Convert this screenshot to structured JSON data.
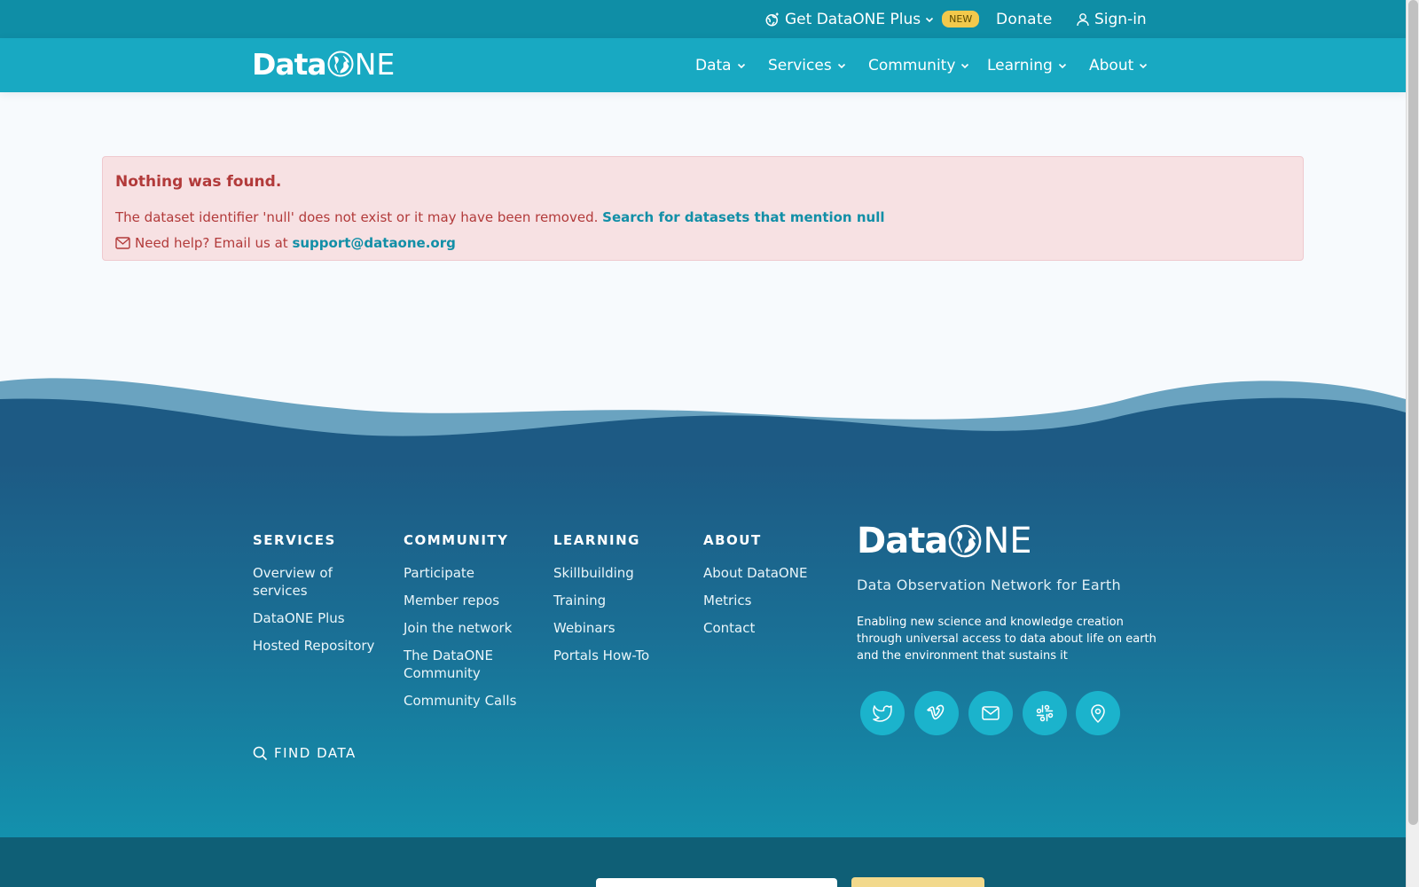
{
  "topbar": {
    "get_plus_label": "Get DataONE Plus",
    "new_badge": "NEW",
    "donate_label": "Donate",
    "signin_label": "Sign-in"
  },
  "brand": {
    "data": "Data",
    "one_o": "O",
    "one_rest": "NE"
  },
  "nav": [
    {
      "label": "Data"
    },
    {
      "label": "Services"
    },
    {
      "label": "Community"
    },
    {
      "label": "Learning"
    },
    {
      "label": "About"
    }
  ],
  "alert": {
    "title": "Nothing was found.",
    "message": "The dataset identifier 'null' does not exist or it may have been removed.",
    "search_link": "Search for datasets that mention null",
    "help_text": "Need help? Email us at",
    "help_email": "support@dataone.org"
  },
  "footer": {
    "columns": [
      {
        "heading": "SERVICES",
        "links": [
          "Overview of services",
          "DataONE Plus",
          "Hosted Repository"
        ]
      },
      {
        "heading": "COMMUNITY",
        "links": [
          "Participate",
          "Member repos",
          "Join the network",
          "The DataONE Community",
          "Community Calls"
        ]
      },
      {
        "heading": "LEARNING",
        "links": [
          "Skillbuilding",
          "Training",
          "Webinars",
          "Portals How-To"
        ]
      },
      {
        "heading": "ABOUT",
        "links": [
          "About DataONE",
          "Metrics",
          "Contact"
        ]
      }
    ],
    "find_data": "FIND DATA",
    "tagline": "Data Observation Network for Earth",
    "mission": "Enabling new science and knowledge creation through universal access to data about life on earth and the environment that sustains it",
    "social": [
      "twitter-icon",
      "vimeo-icon",
      "mail-icon",
      "slack-icon",
      "map-pin-icon"
    ]
  },
  "colors": {
    "topbar": "#0f8ea6",
    "navbar": "#18a9c2",
    "alert_bg": "#f7e1e3",
    "alert_text": "#b23a3a",
    "link": "#128fa7",
    "footer_top": "#1d5a84",
    "footer_bottom": "#1391ad",
    "badge": "#f2c94c"
  }
}
